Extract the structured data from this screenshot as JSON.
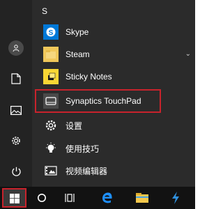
{
  "start_menu": {
    "section_letter": "S",
    "apps": [
      {
        "label": "Skype",
        "icon": "skype-icon",
        "tile_color": "#0078d7"
      },
      {
        "label": "Steam",
        "icon": "folder-icon",
        "tile_color": "#f0c75a",
        "expandable": true
      },
      {
        "label": "Sticky Notes",
        "icon": "sticky-notes-icon",
        "tile_color": "#f7d634"
      },
      {
        "label": "Synaptics TouchPad",
        "icon": "touchpad-icon",
        "tile_color": "#4a4a4a",
        "highlighted": true
      },
      {
        "label": "设置",
        "icon": "settings-gear-icon",
        "tile_color": "#3b3b3b"
      },
      {
        "label": "使用技巧",
        "icon": "lightbulb-icon",
        "tile_color": "#3b3b3b"
      },
      {
        "label": "视频编辑器",
        "icon": "video-editor-icon",
        "tile_color": "#3b3b3b"
      }
    ]
  },
  "rail": [
    "user-avatar-icon",
    "documents-icon",
    "pictures-icon",
    "settings-icon",
    "power-icon"
  ],
  "taskbar": [
    "windows-start-icon",
    "cortana-search-icon",
    "task-view-icon",
    "edge-icon",
    "file-explorer-icon",
    "visual-studio-icon"
  ],
  "colors": {
    "highlight_border": "#c8232c",
    "accent": "#0078d7"
  }
}
